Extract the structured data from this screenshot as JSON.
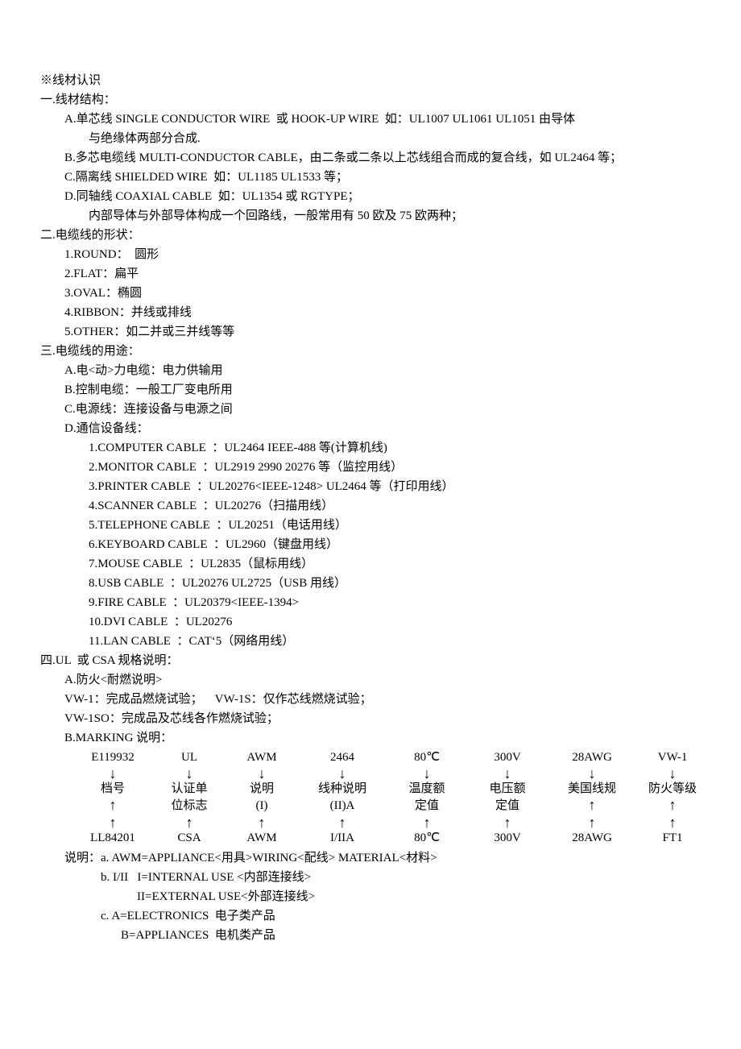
{
  "title": "※线材认识",
  "s1": {
    "heading": "一.线材结构：",
    "a1": "A.单芯线 SINGLE CONDUCTOR WIRE  或 HOOK-UP WIRE  如：UL1007 UL1061 UL1051 由导体",
    "a1b": "与绝缘体两部分合成.",
    "b": "B.多芯电缆线 MULTI-CONDUCTOR CABLE，由二条或二条以上芯线组合而成的复合线，如 UL2464 等；",
    "c": "C.隔离线 SHIELDED WIRE  如：UL1185 UL1533 等；",
    "d": "D.同轴线 COAXIAL CABLE  如：UL1354 或 RGTYPE；",
    "d2": "内部导体与外部导体构成一个回路线，一般常用有 50 欧及 75 欧两种；"
  },
  "s2": {
    "heading": "二.电缆线的形状：",
    "i1": "1.ROUND：  圆形",
    "i2": "2.FLAT：扁平",
    "i3": "3.OVAL：椭圆",
    "i4": "4.RIBBON：并线或排线",
    "i5": "5.OTHER：如二并或三并线等等"
  },
  "s3": {
    "heading": "三.电缆线的用途：",
    "a": "A.电<动>力电缆：电力供输用",
    "b": "B.控制电缆：一般工厂变电所用",
    "c": "C.电源线：连接设备与电源之间",
    "d": "D.通信设备线：",
    "d1": "1.COMPUTER CABLE  ：UL2464 IEEE-488 等(计算机线)",
    "d2": "2.MONITOR CABLE  ：UL2919 2990 20276 等（监控用线）",
    "d3": "3.PRINTER CABLE  ：UL20276<IEEE-1248> UL2464 等（打印用线）",
    "d4": "4.SCANNER CABLE  ：UL20276（扫描用线）",
    "d5": "5.TELEPHONE CABLE  ：UL20251（电话用线）",
    "d6": "6.KEYBOARD CABLE  ：UL2960（键盘用线）",
    "d7": "7.MOUSE CABLE  ：UL2835（鼠标用线）",
    "d8": "8.USB CABLE  ：UL20276 UL2725（USB 用线）",
    "d9": "9.FIRE CABLE  ：UL20379<IEEE-1394>",
    "d10": "10.DVI CABLE  ：UL20276",
    "d11": "11.LAN CABLE  ：CAT‘5（网络用线）"
  },
  "s4": {
    "heading": "四.UL  或 CSA 规格说明：",
    "a": "A.防火<耐燃说明>",
    "a1": "VW-1：完成品燃烧试验；    VW-1S：仅作芯线燃烧试验；",
    "a2": "VW-1SO：完成品及芯线各作燃烧试验；",
    "b": "B.MARKING 说明：",
    "diagram": {
      "top": [
        "E119932",
        "UL",
        "AWM",
        "2464",
        "80℃",
        "300V",
        "28AWG",
        "VW-1"
      ],
      "mid1": [
        "档号",
        "认证单",
        "说明",
        "线种说明",
        "温度额",
        "电压额",
        "美国线规",
        "防火等级"
      ],
      "mid2": [
        "",
        "位标志",
        "(I)",
        "(II)A",
        "定值",
        "定值",
        "",
        ""
      ],
      "bottom": [
        "LL84201",
        "CSA",
        "AWM",
        "I/IIA",
        "80℃",
        "300V",
        "28AWG",
        "FT1"
      ]
    },
    "notes_label": "说明：",
    "na": "a. AWM=APPLIANCE<用具>WIRING<配线> MATERIAL<材料>",
    "nb1": "b. I/II   I=INTERNAL USE <内部连接线>",
    "nb2": "II=EXTERNAL USE<外部连接线>",
    "nc1": "c. A=ELECTRONICS  电子类产品",
    "nc2": "B=APPLIANCES  电机类产品"
  }
}
